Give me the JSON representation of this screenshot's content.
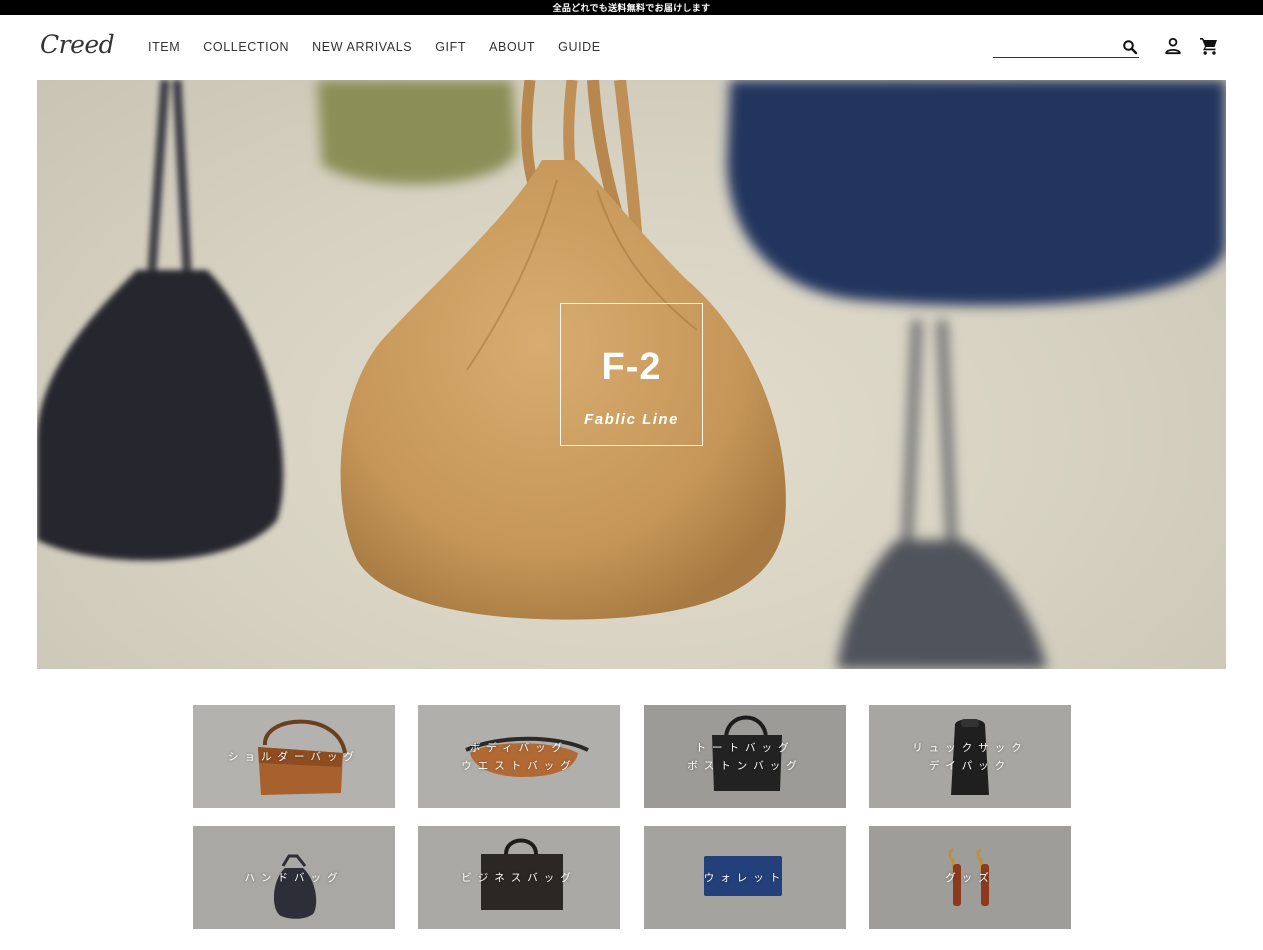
{
  "topbar": {
    "text": "全品どれでも送料無料でお届けします"
  },
  "header": {
    "logo": "Creed",
    "nav": [
      "ITEM",
      "COLLECTION",
      "NEW ARRIVALS",
      "GIFT",
      "ABOUT",
      "GUIDE"
    ],
    "search": {
      "value": "",
      "placeholder": ""
    },
    "icons": {
      "search": "search-icon",
      "account": "account-icon",
      "cart": "cart-icon"
    }
  },
  "hero": {
    "title": "F-2",
    "subtitle": "Fablic Line"
  },
  "categories": [
    {
      "lines": [
        "ショルダーバッグ",
        ""
      ]
    },
    {
      "lines": [
        "ボディバッグ",
        "ウエストバッグ"
      ]
    },
    {
      "lines": [
        "トートバッグ",
        "ボストンバッグ"
      ]
    },
    {
      "lines": [
        "リュックサック",
        "デイパック"
      ]
    },
    {
      "lines": [
        "ハンドバッグ",
        ""
      ]
    },
    {
      "lines": [
        "ビジネスバッグ",
        ""
      ]
    },
    {
      "lines": [
        "ウォレット",
        ""
      ]
    },
    {
      "lines": [
        "グッズ",
        ""
      ]
    }
  ],
  "colors": {
    "topbar": "#000000",
    "text": "#333333",
    "hero_bag": "#c79a60"
  }
}
